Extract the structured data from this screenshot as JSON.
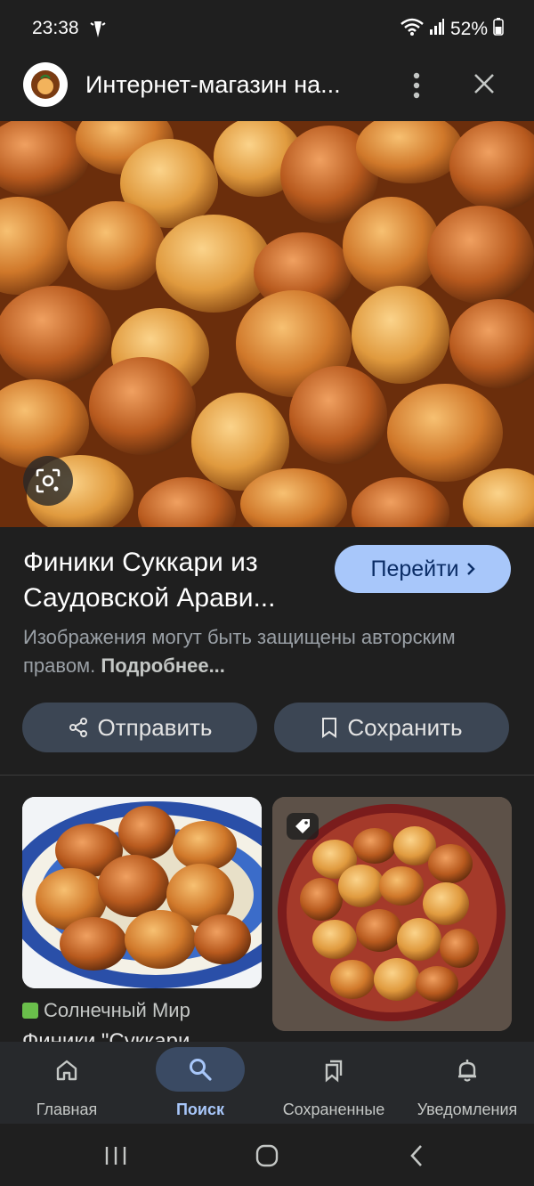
{
  "status": {
    "time": "23:38",
    "battery": "52%"
  },
  "header": {
    "title": "Интернет-магазин на..."
  },
  "result": {
    "title_line1": "Финики Суккари из",
    "title_line2": "Саудовской Арави...",
    "go_label": "Перейти",
    "copyright_text": "Изображения могут быть защищены авторским правом.",
    "more_link": "Подробнее..."
  },
  "actions": {
    "share_label": "Отправить",
    "save_label": "Сохранить"
  },
  "related": {
    "source": "Солнечный Мир",
    "title": "Финики \"Суккари"
  },
  "nav": {
    "items": [
      {
        "label": "Главная",
        "icon": "home-icon"
      },
      {
        "label": "Поиск",
        "icon": "search-icon"
      },
      {
        "label": "Сохраненные",
        "icon": "bookmarks-icon"
      },
      {
        "label": "Уведомления",
        "icon": "bell-icon"
      }
    ],
    "active": "Поиск"
  },
  "colors": {
    "accent": "#a8c7fa",
    "background": "#1f1f1f",
    "pill": "#3c4654"
  }
}
